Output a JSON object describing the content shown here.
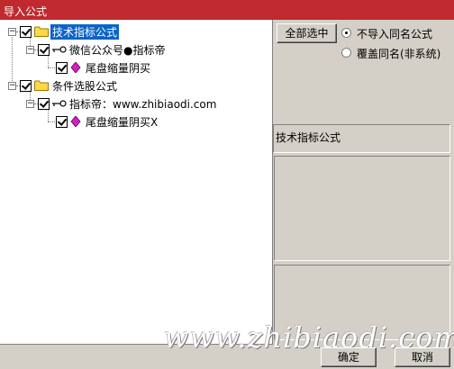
{
  "window": {
    "title": "导入公式"
  },
  "tree": {
    "root1": {
      "label": "技术指标公式"
    },
    "child1": {
      "label": "微信公众号●指标帝"
    },
    "leaf1": {
      "label": "尾盘缩量阴买"
    },
    "root2": {
      "label": "条件选股公式"
    },
    "child2": {
      "label": "指标帝：www.zhibiaodi.com"
    },
    "leaf2": {
      "label": "尾盘缩量阴买X"
    }
  },
  "options": {
    "select_all_label": "全部选中",
    "radio_no_import": "不导入同名公式",
    "radio_overwrite": "覆盖同名(非系统)",
    "selected": "不导入同名公式"
  },
  "info": {
    "category": "技术指标公式"
  },
  "buttons": {
    "ok": "确定",
    "cancel": "取消"
  },
  "watermark": "www.zhibiaodi.com",
  "colors": {
    "titlebar": "#c0292e",
    "selection": "#0a64c8",
    "folder": "#ffd84a"
  }
}
